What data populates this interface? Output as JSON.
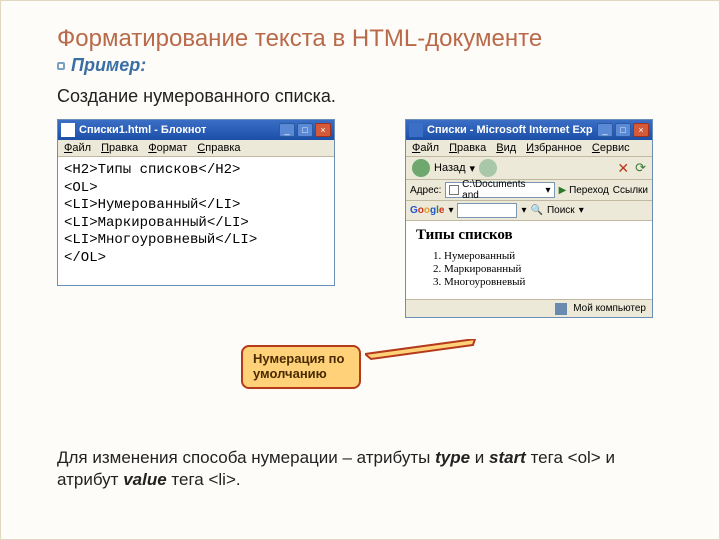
{
  "title": "Форматирование текста в HTML-документе",
  "example_label": "Пример:",
  "subtitle": "Создание нумерованного списка.",
  "notepad": {
    "title": "Списки1.html - Блокнот",
    "menu": [
      "Файл",
      "Правка",
      "Формат",
      "Справка"
    ],
    "code_lines": [
      "<H2>Типы списков</H2>",
      "<OL>",
      "  <LI>Нумерованный</LI>",
      "  <LI>Маркированный</LI>",
      "  <LI>Многоуровневый</LI>",
      "</OL>"
    ]
  },
  "ie": {
    "title": "Списки - Microsoft Internet Explorer",
    "menu": [
      "Файл",
      "Правка",
      "Вид",
      "Избранное",
      "Сервис"
    ],
    "back_label": "Назад",
    "addr_label": "Адрес:",
    "addr_value": "C:\\Documents and",
    "go_label": "Переход",
    "links_label": "Ссылки",
    "google_label": "Google",
    "search_label": "Поиск",
    "heading": "Типы списков",
    "items": [
      "Нумерованный",
      "Маркированный",
      "Многоуровневый"
    ],
    "status": "Мой компьютер"
  },
  "callout": "Нумерация по умолчанию",
  "footnote": {
    "part1": "Для изменения способа нумерации – атрибуты ",
    "type": "type",
    "part2": " и ",
    "start": "start",
    "part3": "  тега ",
    "ol_tag": "<ol>",
    "part4": "  и атрибут  ",
    "value": "value",
    "part5": " тега ",
    "li_tag": "<li>",
    "part6": "."
  }
}
